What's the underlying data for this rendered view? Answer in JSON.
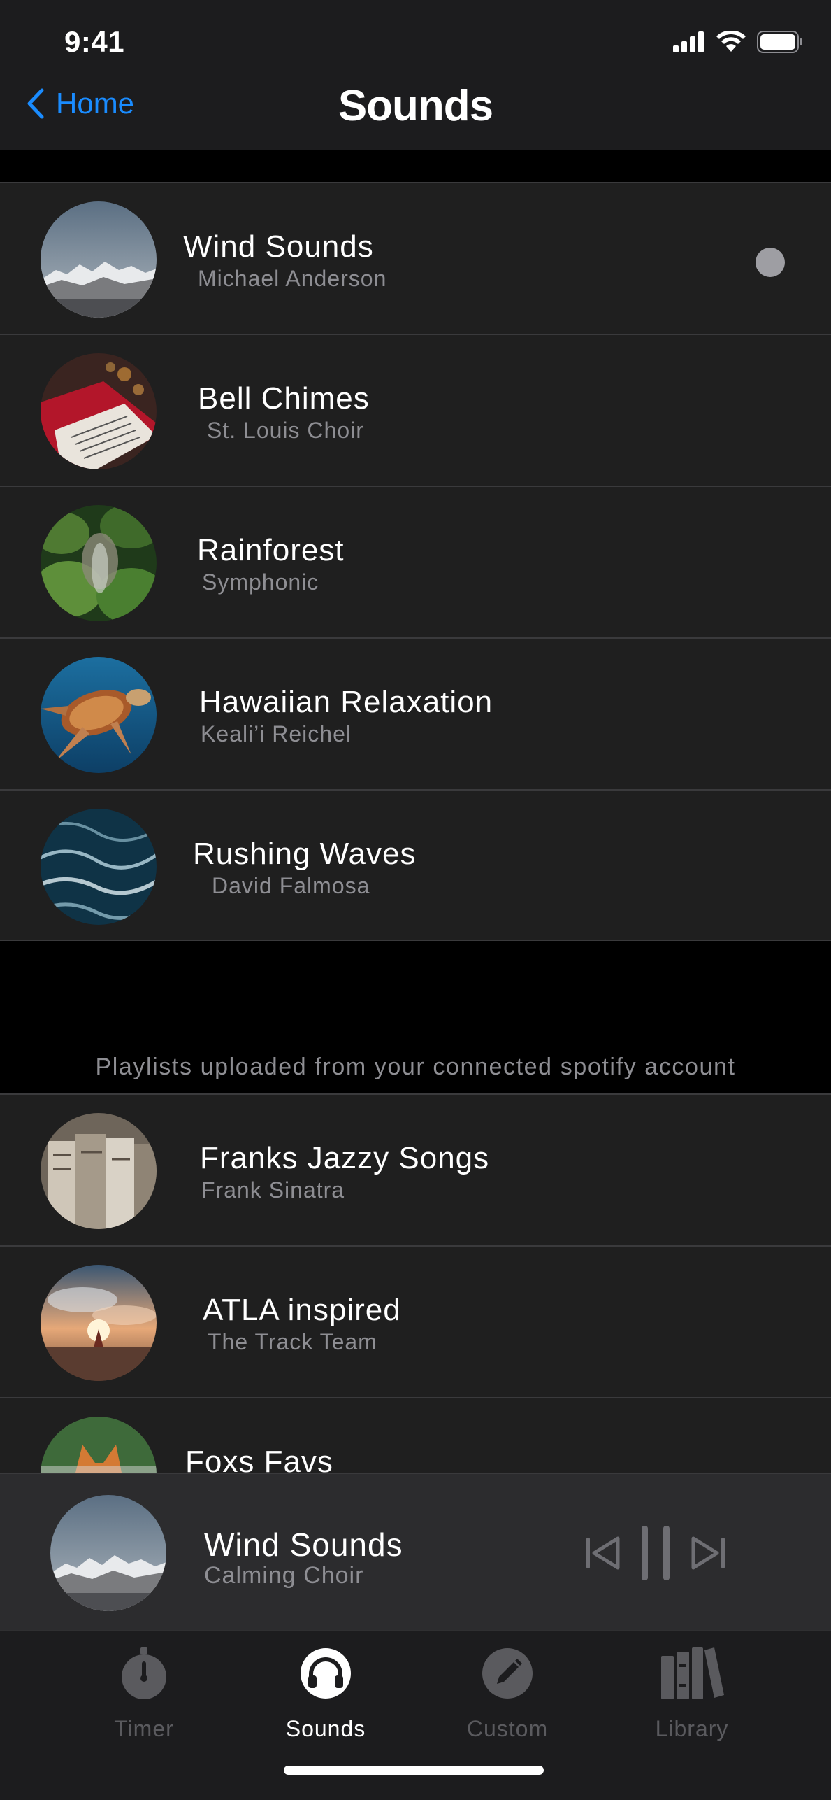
{
  "status_bar": {
    "time": "9:41"
  },
  "nav": {
    "back_label": "Home",
    "title": "Sounds"
  },
  "sounds": [
    {
      "title": "Wind Sounds",
      "subtitle": "Michael Anderson",
      "image": "mountains"
    },
    {
      "title": "Bell Chimes",
      "subtitle": "St. Louis Choir",
      "image": "sheet-music"
    },
    {
      "title": "Rainforest",
      "subtitle": "Symphonic",
      "image": "rainforest"
    },
    {
      "title": "Hawaiian Relaxation",
      "subtitle": "Keali’i Reichel",
      "image": "sea-turtle"
    },
    {
      "title": "Rushing Waves",
      "subtitle": "David Falmosa",
      "image": "ocean-waves"
    }
  ],
  "playlists_caption": "Playlists uploaded from your connected spotify account",
  "playlists": [
    {
      "title": "Franks Jazzy Songs",
      "subtitle": "Frank Sinatra",
      "image": "vinyl-records"
    },
    {
      "title": "ATLA inspired",
      "subtitle": "The Track Team",
      "image": "sunset-meditation"
    },
    {
      "title": "Foxs Favs",
      "subtitle": "",
      "image": "fox"
    }
  ],
  "now_playing": {
    "title": "Wind Sounds",
    "subtitle": "Calming Choir",
    "image": "mountains"
  },
  "tabs": [
    {
      "label": "Timer",
      "icon": "stopwatch-icon",
      "active": false
    },
    {
      "label": "Sounds",
      "icon": "headphones-icon",
      "active": true
    },
    {
      "label": "Custom",
      "icon": "pencil-icon",
      "active": false
    },
    {
      "label": "Library",
      "icon": "books-icon",
      "active": false
    }
  ],
  "colors": {
    "accent": "#1a8cff",
    "background": "#1f1f1f",
    "secondary_text": "#8e8e93",
    "inactive_tab": "#5a5a5e"
  }
}
